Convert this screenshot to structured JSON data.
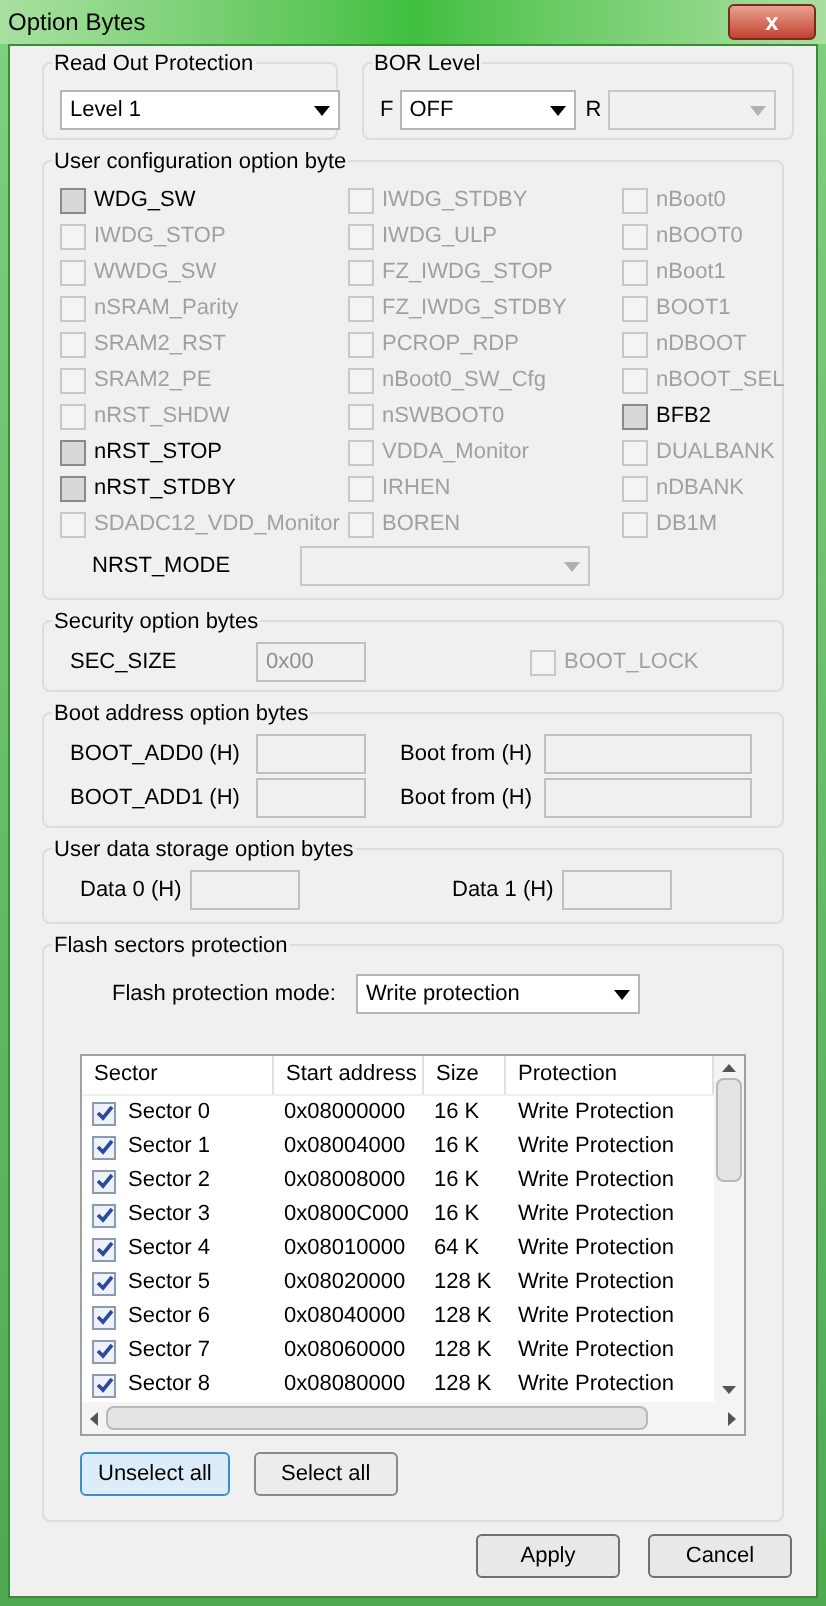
{
  "window": {
    "title": "Option Bytes",
    "close": "x"
  },
  "read_out_protection": {
    "label": "Read Out Protection",
    "value": "Level 1"
  },
  "bor_level": {
    "label": "BOR Level",
    "f_label": "F",
    "f_value": "OFF",
    "r_label": "R",
    "r_disabled": true
  },
  "user_config": {
    "label": "User configuration option byte",
    "options": [
      {
        "label": "WDG_SW",
        "checked": false,
        "disabled": false
      },
      {
        "label": "IWDG_STDBY",
        "checked": false,
        "disabled": true
      },
      {
        "label": "nBoot0",
        "checked": false,
        "disabled": true
      },
      {
        "label": "IWDG_STOP",
        "checked": false,
        "disabled": true
      },
      {
        "label": "IWDG_ULP",
        "checked": false,
        "disabled": true
      },
      {
        "label": "nBOOT0",
        "checked": false,
        "disabled": true
      },
      {
        "label": "WWDG_SW",
        "checked": false,
        "disabled": true
      },
      {
        "label": "FZ_IWDG_STOP",
        "checked": false,
        "disabled": true
      },
      {
        "label": "nBoot1",
        "checked": false,
        "disabled": true
      },
      {
        "label": "nSRAM_Parity",
        "checked": false,
        "disabled": true
      },
      {
        "label": "FZ_IWDG_STDBY",
        "checked": false,
        "disabled": true
      },
      {
        "label": "BOOT1",
        "checked": false,
        "disabled": true
      },
      {
        "label": "SRAM2_RST",
        "checked": false,
        "disabled": true
      },
      {
        "label": "PCROP_RDP",
        "checked": false,
        "disabled": true
      },
      {
        "label": "nDBOOT",
        "checked": false,
        "disabled": true
      },
      {
        "label": "SRAM2_PE",
        "checked": false,
        "disabled": true
      },
      {
        "label": "nBoot0_SW_Cfg",
        "checked": false,
        "disabled": true
      },
      {
        "label": "nBOOT_SEL",
        "checked": false,
        "disabled": true
      },
      {
        "label": "nRST_SHDW",
        "checked": false,
        "disabled": true
      },
      {
        "label": "nSWBOOT0",
        "checked": false,
        "disabled": true
      },
      {
        "label": "BFB2",
        "checked": false,
        "disabled": false
      },
      {
        "label": "nRST_STOP",
        "checked": false,
        "disabled": false
      },
      {
        "label": "VDDA_Monitor",
        "checked": false,
        "disabled": true
      },
      {
        "label": "DUALBANK",
        "checked": false,
        "disabled": true
      },
      {
        "label": "nRST_STDBY",
        "checked": false,
        "disabled": false
      },
      {
        "label": "IRHEN",
        "checked": false,
        "disabled": true
      },
      {
        "label": "nDBANK",
        "checked": false,
        "disabled": true
      },
      {
        "label": "SDADC12_VDD_Monitor",
        "checked": false,
        "disabled": true
      },
      {
        "label": "BOREN",
        "checked": false,
        "disabled": true
      },
      {
        "label": "DB1M",
        "checked": false,
        "disabled": true
      }
    ],
    "nrst_mode": {
      "label": "NRST_MODE",
      "disabled": true
    }
  },
  "security": {
    "label": "Security option bytes",
    "sec_size_label": "SEC_SIZE",
    "sec_size_value": "0x00",
    "boot_lock": {
      "label": "BOOT_LOCK",
      "checked": false,
      "disabled": true
    }
  },
  "boot_address": {
    "label": "Boot address option bytes",
    "rows": [
      {
        "label": "BOOT_ADD0 (H)",
        "from_label": "Boot from (H)"
      },
      {
        "label": "BOOT_ADD1 (H)",
        "from_label": "Boot from (H)"
      }
    ]
  },
  "user_data": {
    "label": "User data storage option bytes",
    "fields": [
      "Data 0 (H)",
      "Data 1 (H)"
    ]
  },
  "flash_protection": {
    "label": "Flash sectors protection",
    "mode_label": "Flash protection mode:",
    "mode_value": "Write protection",
    "columns": [
      "Sector",
      "Start address",
      "Size",
      "Protection"
    ],
    "rows": [
      {
        "sector": "Sector 0",
        "address": "0x08000000",
        "size": "16 K",
        "protection": "Write Protection",
        "checked": true
      },
      {
        "sector": "Sector 1",
        "address": "0x08004000",
        "size": "16 K",
        "protection": "Write Protection",
        "checked": true
      },
      {
        "sector": "Sector 2",
        "address": "0x08008000",
        "size": "16 K",
        "protection": "Write Protection",
        "checked": true
      },
      {
        "sector": "Sector 3",
        "address": "0x0800C000",
        "size": "16 K",
        "protection": "Write Protection",
        "checked": true
      },
      {
        "sector": "Sector 4",
        "address": "0x08010000",
        "size": "64 K",
        "protection": "Write Protection",
        "checked": true
      },
      {
        "sector": "Sector 5",
        "address": "0x08020000",
        "size": "128 K",
        "protection": "Write Protection",
        "checked": true
      },
      {
        "sector": "Sector 6",
        "address": "0x08040000",
        "size": "128 K",
        "protection": "Write Protection",
        "checked": true
      },
      {
        "sector": "Sector 7",
        "address": "0x08060000",
        "size": "128 K",
        "protection": "Write Protection",
        "checked": true
      },
      {
        "sector": "Sector 8",
        "address": "0x08080000",
        "size": "128 K",
        "protection": "Write Protection",
        "checked": true
      }
    ],
    "buttons": [
      "Unselect all",
      "Select all"
    ]
  },
  "footer_buttons": [
    "Apply",
    "Cancel"
  ]
}
